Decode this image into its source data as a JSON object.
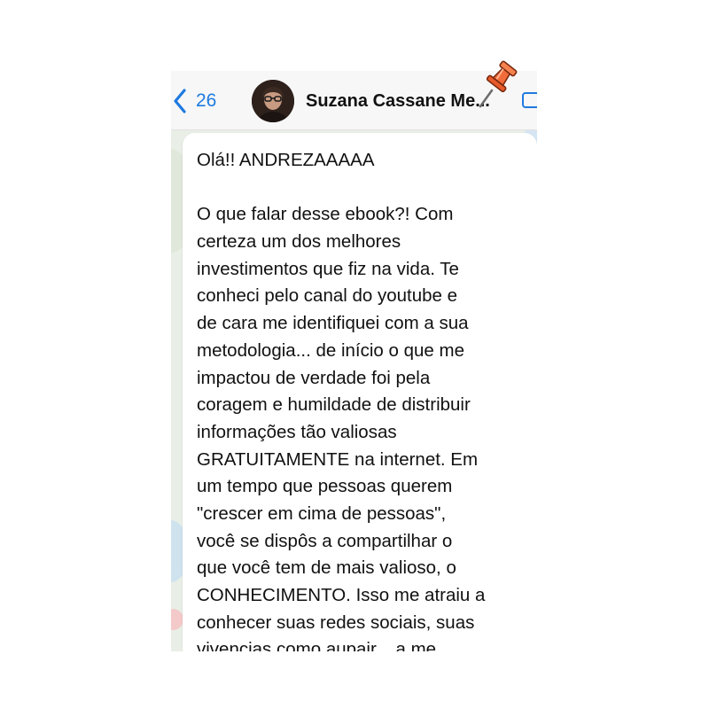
{
  "header": {
    "back_count": "26",
    "contact_name": "Suzana Cassane Me..."
  },
  "message": {
    "lines": [
      "Olá!! ANDREZAAAAA",
      "",
      "O que falar desse ebook?! Com",
      "certeza um dos melhores",
      "investimentos que fiz na vida. Te",
      "conheci pelo canal do youtube e",
      "de cara me identifiquei com a sua",
      "metodologia... de início o que me",
      "impactou de verdade foi pela",
      "coragem e humildade de distribuir",
      "informações tão valiosas",
      "GRATUITAMENTE na internet. Em",
      "um tempo que pessoas querem",
      "\"crescer em cima de pessoas\",",
      "você se dispôs a compartilhar o",
      "que você tem de mais valioso, o",
      "CONHECIMENTO. Isso me atraiu a",
      "conhecer suas redes sociais, suas",
      "vivencias como aupair... a me"
    ]
  },
  "icons": {
    "back": "chevron-left-icon",
    "video": "video-call-icon",
    "pin": "pushpin-icon"
  },
  "colors": {
    "accent": "#1f7ae0",
    "pin": "#f26b3a",
    "bubble": "#ffffff"
  }
}
